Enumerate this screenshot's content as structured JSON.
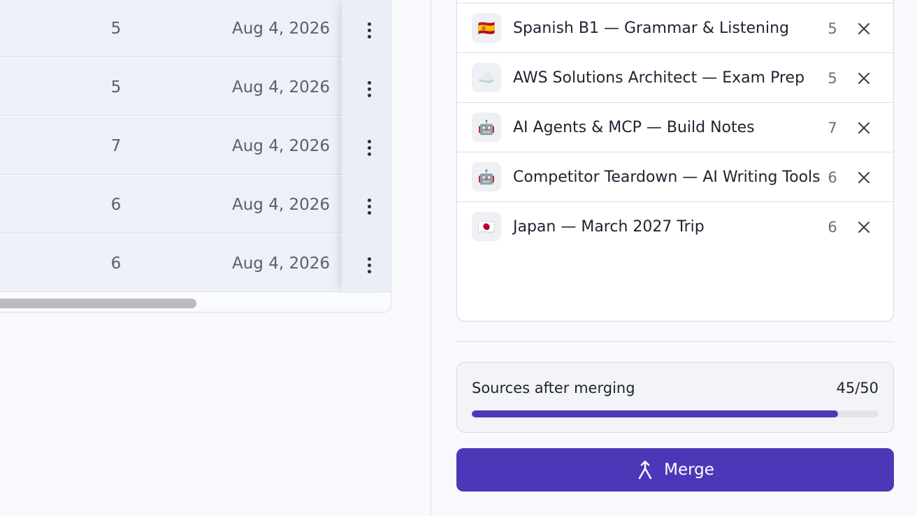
{
  "table": {
    "rows": [
      {
        "count": "5",
        "date": "Aug 4, 2026"
      },
      {
        "count": "5",
        "date": "Aug 4, 2026"
      },
      {
        "count": "7",
        "date": "Aug 4, 2026"
      },
      {
        "count": "6",
        "date": "Aug 4, 2026"
      },
      {
        "count": "6",
        "date": "Aug 4, 2026"
      }
    ]
  },
  "merge_panel": {
    "items": [
      {
        "emoji": "🇪🇸",
        "title": "Spanish B1 — Grammar & Listening",
        "count": "5"
      },
      {
        "emoji": "☁️",
        "title": "AWS Solutions Architect — Exam Prep",
        "count": "5"
      },
      {
        "emoji": "🤖",
        "title": "AI Agents & MCP — Build Notes",
        "count": "7"
      },
      {
        "emoji": "🤖",
        "title": "Competitor Teardown — AI Writing Tools",
        "count": "6"
      },
      {
        "emoji": "🇯🇵",
        "title": "Japan — March 2027 Trip",
        "count": "6"
      }
    ],
    "sources": {
      "label": "Sources after merging",
      "value": "45/50",
      "current": 45,
      "max": 50
    },
    "merge_label": "Merge"
  },
  "icons": {
    "row_menu": "more-vertical-icon",
    "remove": "close-icon",
    "merge": "merge-arrow-icon"
  },
  "colors": {
    "accent": "#4a38b8",
    "row_background": "#eef0f8",
    "panel_background": "#f8f9fd"
  }
}
